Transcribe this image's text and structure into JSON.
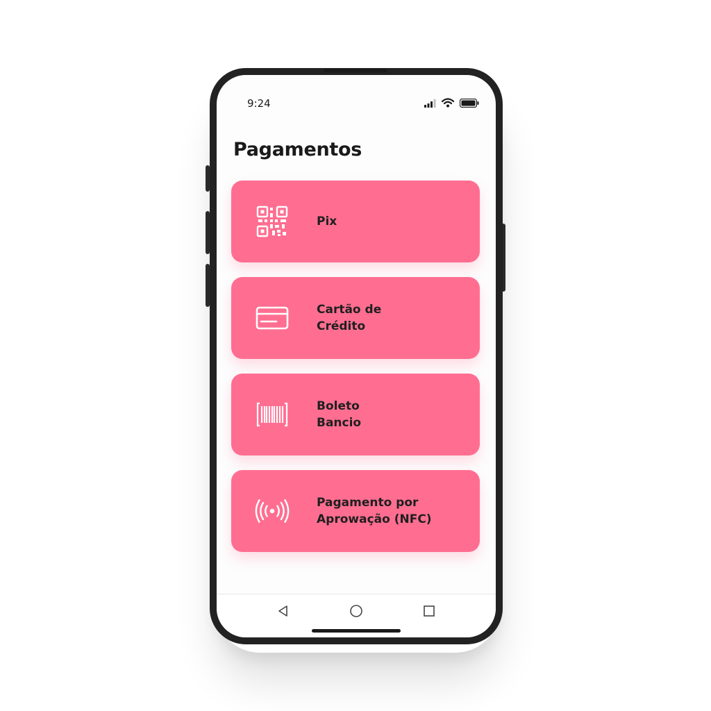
{
  "status_bar": {
    "time": "9:24",
    "icons": [
      "signal-icon",
      "wifi-icon",
      "battery-icon"
    ]
  },
  "page": {
    "title": "Pagamentos"
  },
  "menu": {
    "items": [
      {
        "label": "Pix",
        "icon": "qr-code-icon"
      },
      {
        "label": "Cartão de\nCrédito",
        "icon": "credit-card-icon"
      },
      {
        "label": "Boleto\nBancio",
        "icon": "barcode-icon"
      },
      {
        "label": "Pagamento por\nAprowação (NFC)",
        "icon": "nfc-icon"
      }
    ]
  },
  "nav_bar": {
    "buttons": [
      "back-icon",
      "home-icon",
      "recents-icon"
    ]
  },
  "colors": {
    "card": "#ff6e91",
    "frame": "#222222",
    "screen": "#fdfdfd"
  }
}
